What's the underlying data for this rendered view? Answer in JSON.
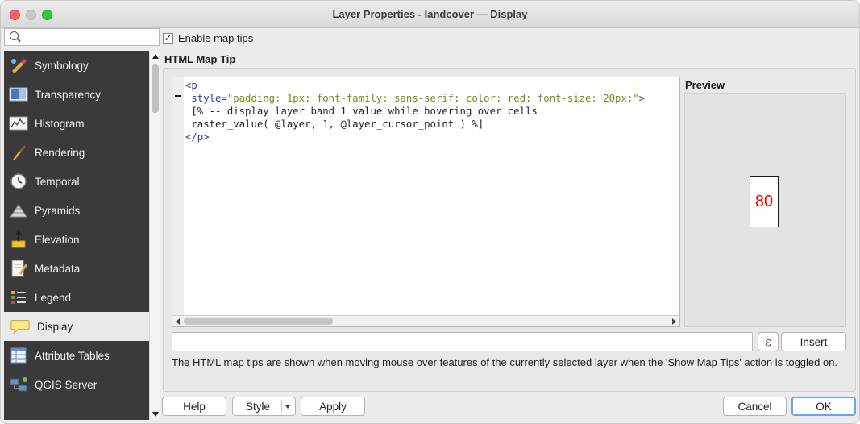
{
  "window": {
    "title": "Layer Properties - landcover — Display"
  },
  "sidebar": {
    "search": {
      "placeholder": "",
      "value": ""
    },
    "items": [
      {
        "label": "Symbology",
        "icon": "symbology-icon"
      },
      {
        "label": "Transparency",
        "icon": "transparency-icon"
      },
      {
        "label": "Histogram",
        "icon": "histogram-icon"
      },
      {
        "label": "Rendering",
        "icon": "rendering-icon"
      },
      {
        "label": "Temporal",
        "icon": "temporal-icon"
      },
      {
        "label": "Pyramids",
        "icon": "pyramids-icon"
      },
      {
        "label": "Elevation",
        "icon": "elevation-icon"
      },
      {
        "label": "Metadata",
        "icon": "metadata-icon"
      },
      {
        "label": "Legend",
        "icon": "legend-icon"
      },
      {
        "label": "Display",
        "icon": "display-icon",
        "selected": true
      },
      {
        "label": "Attribute Tables",
        "icon": "attribute-tables-icon"
      },
      {
        "label": "QGIS Server",
        "icon": "qgis-server-icon"
      }
    ]
  },
  "main": {
    "enable_map_tips": {
      "label": "Enable map tips",
      "checked": true,
      "mark": "✓"
    },
    "section_title": "HTML Map Tip",
    "code": {
      "line1_tag": "<p",
      "line2_attr": "style=",
      "line2_value": "\"padding: 1px; font-family: sans-serif; color: red; font-size: 20px;\"",
      "line2_end": ">",
      "line3": "[% -- display layer band 1 value while hovering over cells",
      "line4": "raster_value( @layer, 1, @layer_cursor_point ) %]",
      "line5": "</p>"
    },
    "preview": {
      "label": "Preview",
      "value": "80"
    },
    "expression": {
      "value": "",
      "epsilon_label": "ε",
      "insert_label": "Insert"
    },
    "help_text": "The HTML map tips are shown when moving mouse over features of the currently selected layer when the 'Show Map Tips' action is toggled on."
  },
  "buttons": {
    "help": "Help",
    "style": "Style",
    "apply": "Apply",
    "cancel": "Cancel",
    "ok": "OK"
  },
  "colors": {
    "sidebar_bg": "#3a3a3a",
    "selected_bg": "#e9e9e9",
    "preview_text": "#ff0000",
    "code_tag": "#1f3fa8",
    "code_value": "#6d8f1a",
    "ok_border": "#6aa3e8"
  }
}
